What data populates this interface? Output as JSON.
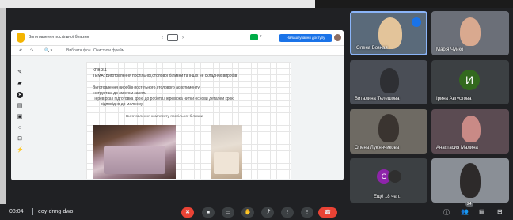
{
  "presentation": {
    "title": "Виготовлення постільної білизни",
    "share_label": "Налаштування доступу",
    "toolbar": {
      "undo": "↶",
      "redo": "↷",
      "zoom": "🔍 ▾",
      "background": "Вибрати фон",
      "clear": "Очистити фрейм"
    },
    "frame_nav": {
      "prev": "‹",
      "next": "›"
    },
    "canvas": {
      "line1": "КРВ 3.1",
      "line2": "ТЕМА: Виготовлення постільної,столової білизни та іншіх не складних виробів",
      "line3": "Виготовлення виробів постільного,столового асортименту",
      "line4": "Інструктаж до змістом занять",
      "line5": "Перевірка і підготовка крою до роботи.Перевірка нитки основи деталей крою",
      "line6": "відповідно до малюнку.",
      "caption": "Виготовлення комплекту постільної білизни"
    }
  },
  "participants": [
    {
      "name": "Олена Бозная",
      "speaking": true
    },
    {
      "name": "Марія Чуйко"
    },
    {
      "name": "Виталина Телешова"
    },
    {
      "name": "Ірина Августова",
      "initial": "И"
    },
    {
      "name": "Олена Лук'янчикова"
    },
    {
      "name": "Анастасия Малина"
    },
    {
      "name": "Ещё 18 чел.",
      "initial": "С"
    },
    {
      "name": ""
    }
  ],
  "bottom_bar": {
    "time": "08:04",
    "meeting_code": "eoy-dnng-dwo",
    "participant_count": "24"
  },
  "colors": {
    "end_call": "#ea4335",
    "accent": "#1a73e8",
    "background": "#202124"
  }
}
